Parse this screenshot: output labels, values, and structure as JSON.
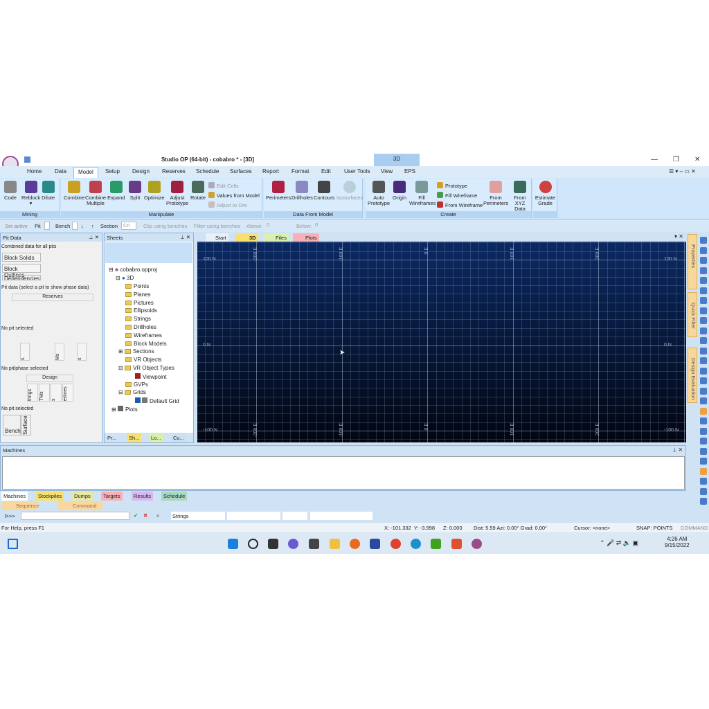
{
  "window": {
    "title": "Studio OP (64-bit) - cobabro * - [3D]",
    "context_tab": "3D"
  },
  "tabs": [
    "Home",
    "Data",
    "Model",
    "Setup",
    "Design",
    "Reserves",
    "Schedule",
    "Surfaces",
    "Report",
    "Format",
    "Edit",
    "User Tools",
    "View",
    "EPS"
  ],
  "active_tab": "Model",
  "ribbon": {
    "mining": {
      "label": "Mining",
      "buttons": [
        "Code",
        "Reblock",
        "Dilute"
      ]
    },
    "manipulate": {
      "label": "Manipulate",
      "buttons": [
        "Combine",
        "Combine Multiple",
        "Expand",
        "Split",
        "Optimize",
        "Adjust Prototype",
        "Rotate"
      ],
      "small": [
        "Edit Cells",
        "Values from Model",
        "Adjust to Ore"
      ]
    },
    "data_from_model": {
      "label": "Data From Model",
      "buttons": [
        "Perimeters",
        "Drillholes",
        "Contours",
        "Isosurfaces"
      ]
    },
    "create": {
      "label": "Create",
      "buttons": [
        "Auto Prototype",
        "Origin",
        "Fill Wireframes",
        "From Perimeters",
        "From XYZ Data"
      ],
      "small": [
        "Prototype",
        "Fill Wireframe",
        "From Wireframe"
      ]
    },
    "estimate": {
      "buttons": [
        "Estimate Grade"
      ]
    }
  },
  "toolbar": {
    "set_active": "Set active",
    "pit": "Pit",
    "bench": "Bench",
    "section": "Section",
    "section_value": "Cri",
    "clip": "Clip using benches",
    "filter": "Filter using benches",
    "above": "Above:",
    "above_value": "0",
    "below": "Below:",
    "below_value": "0"
  },
  "pit_data": {
    "title": "Pit Data",
    "s1": "Combined data for all pits",
    "s1_items": [
      "Block Solids",
      "Block Outlines",
      "Dependencies"
    ],
    "s2": "Pit data (select a pit to show phase data)",
    "s2_header": "Reserves",
    "s3": "No pit selected",
    "s3_cols": [
      "s",
      "Ms",
      "s"
    ],
    "s4": "No pit/phase selected",
    "s4_header": "Design",
    "s4_cols": [
      "trings",
      "TMs",
      "s",
      "erlines"
    ],
    "s5": "No pit selected",
    "s5_cols": [
      "Bench",
      "Surface"
    ]
  },
  "sheets": {
    "title": "Sheets",
    "root": "cobabro.opproj",
    "items": [
      "3D",
      "Points",
      "Planes",
      "Pictures",
      "Ellipsoids",
      "Strings",
      "Drillholes",
      "Wireframes",
      "Block Models",
      "Sections",
      "VR Objects",
      "VR Object Types",
      "Viewpoint",
      "GVPs",
      "Grids",
      "Default Grid",
      "Plots"
    ],
    "bottom_tabs": [
      "Pr...",
      "Sh...",
      "Lo...",
      "Cu..."
    ]
  },
  "doc_tabs": [
    "Start",
    "3D",
    "Files",
    "Plots"
  ],
  "viewport": {
    "e_labels": [
      "-200 E",
      "-100 E",
      "0 E",
      "100 E",
      "200 E"
    ],
    "n_labels": [
      "100 N",
      "0 N",
      "-100 N"
    ]
  },
  "side_tabs": [
    "Properties",
    "Quick Filter",
    "Design Evaluation"
  ],
  "machines": {
    "title": "Machines",
    "tabs": [
      "Machines",
      "Stockpiles",
      "Dumps",
      "Targets",
      "Results",
      "Schedule"
    ]
  },
  "lower_tabs": [
    "Sequence",
    "Command"
  ],
  "cmd": {
    "prompt": "l>>>",
    "layer": "Strings"
  },
  "status": {
    "help": "For Help, press F1",
    "x": "X: -101.332",
    "y": "Y: -3.998",
    "z": "Z: 0.000",
    "dist": "Dist: 5.59 Azi: 0.00° Grad: 0.00°",
    "cursor": "Cursor: <none>",
    "snap": "SNAP: POINTS",
    "mode": "COMMAND"
  },
  "clock": {
    "time": "4:26 AM",
    "date": "9/15/2022"
  }
}
